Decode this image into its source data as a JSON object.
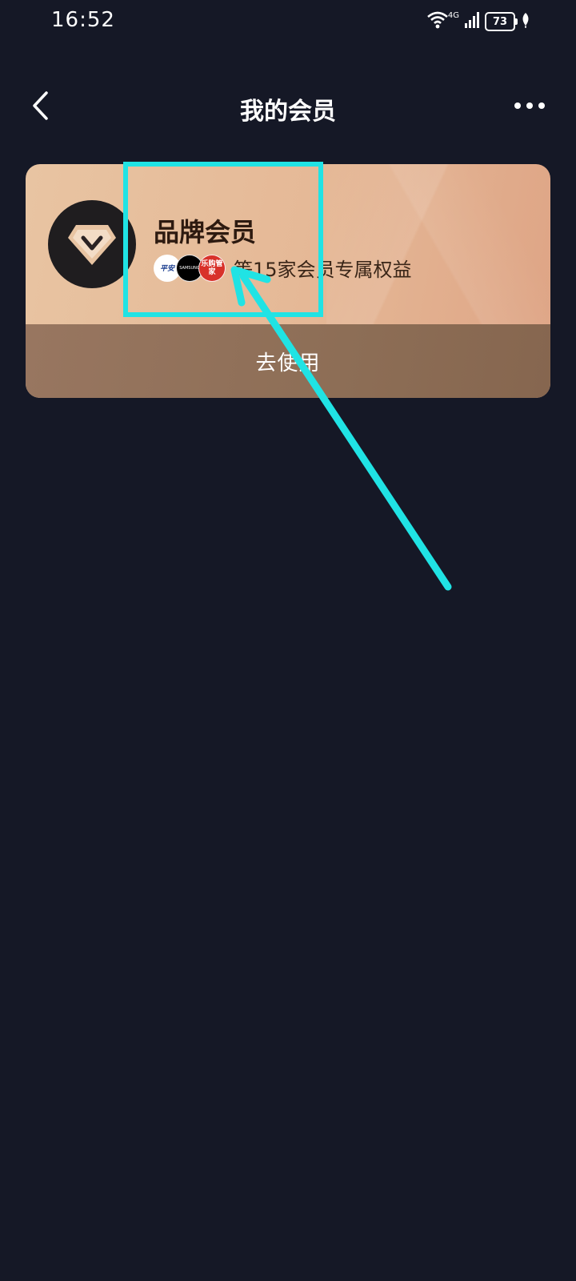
{
  "status_bar": {
    "time": "16:52",
    "network": "4G",
    "battery": "73"
  },
  "header": {
    "title": "我的会员"
  },
  "card": {
    "title": "品牌会员",
    "brands": [
      {
        "name": "brand-badge-1",
        "label": "平安"
      },
      {
        "name": "brand-badge-2",
        "label": "SAMSUNG"
      },
      {
        "name": "brand-badge-3",
        "label": "乐购管家"
      }
    ],
    "benefit_text": "等15家会员专属权益",
    "action_label": "去使用"
  },
  "annotation": {
    "color": "#20e3e4"
  },
  "colors": {
    "background": "#151826",
    "card_top": "#e5b896",
    "card_footer": "#8d6e56",
    "card_title": "#2d1a10"
  }
}
